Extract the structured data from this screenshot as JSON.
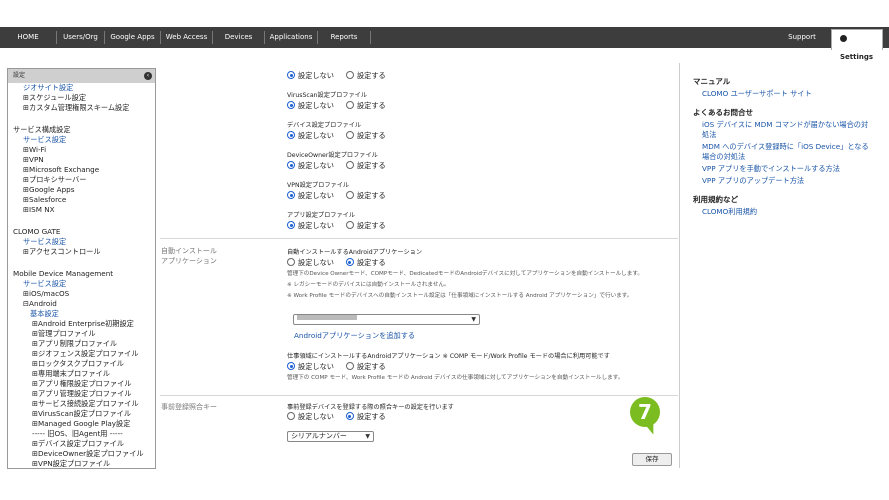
{
  "topnav": {
    "tabs": [
      "HOME",
      "Users/Org",
      "Google Apps",
      "Web Access",
      "Devices",
      "Applications",
      "Reports"
    ],
    "support": "Support",
    "settings": "Settings"
  },
  "sidebar": {
    "header": "設定",
    "items": [
      "ジオサイト設定",
      "⊞スケジュール設定",
      "⊞カスタム管理権限スキーム設定",
      "サービス構成設定",
      "サービス設定",
      "⊞Wi-Fi",
      "⊞VPN",
      "⊞Microsoft Exchange",
      "⊞プロキシサーバー",
      "⊞Google Apps",
      "⊞Salesforce",
      "⊞ISM NX",
      "CLOMO GATE",
      "サービス設定",
      "⊞アクセスコントロール",
      "Mobile Device Management",
      "サービス設定",
      "⊞iOS/macOS",
      "⊟Android",
      "基本設定",
      "⊞Android Enterprise初期設定",
      "⊞管理プロファイル",
      "⊞アプリ制限プロファイル",
      "⊞ジオフェンス設定プロファイル",
      "⊞ロックタスクプロファイル",
      "⊞専用端末プロファイル",
      "⊞アプリ権限設定プロファイル",
      "⊞アプリ管理設定プロファイル",
      "⊞サービス接続設定プロファイル",
      "⊞VirusScan設定プロファイル",
      "⊞Managed Google Play設定",
      "----- 旧OS、旧Agent用 -----",
      "⊞デバイス設定プロファイル",
      "⊞DeviceOwner設定プロファイル",
      "⊞VPN設定プロファイル"
    ]
  },
  "main": {
    "opt_off": "設定しない",
    "opt_on": "設定する",
    "profiles": [
      "VirusScan設定プロファイル",
      "デバイス設定プロファイル",
      "DeviceOwner設定プロファイル",
      "VPN設定プロファイル",
      "アプリ設定プロファイル"
    ],
    "auto_install_label": "自動インストール\nアプリケーション",
    "auto_install_title": "自動インストールするAndroidアプリケーション",
    "auto_install_notes": [
      "管理下のDevice Ownerモード、COMPモード、DedicatedモードのAndroidデバイスに対してアプリケーションを自動インストールします。",
      "※ レガシーモードのデバイスには自動インストールされません。",
      "※ Work Profile モードのデバイスへの自動インストール設定は「仕事領域にインストールする Android アプリケーション」で行います。"
    ],
    "add_app_link": "Androidアプリケーションを追加する",
    "work_title": "仕事領域にインストールするAndroidアプリケーション ※ COMP モード/Work Profile モードの場合に利用可能です",
    "work_note": "管理下の COMP モード、Work Profile モードの Android デバイスの仕事領域に対してアプリケーションを自動インストールします。",
    "prereg_label": "事前登録照合キー",
    "prereg_title": "事前登録デバイスを登録する際の照合キーの設定を行います",
    "prereg_select": "シリアルナンバー",
    "save": "保存",
    "step": "7"
  },
  "right": {
    "h1": "マニュアル",
    "l1": "CLOMO ユーザーサポート サイト",
    "h2": "よくあるお問合せ",
    "faq": [
      "iOS デバイスに MDM コマンドが届かない場合の対",
      "処法",
      "MDM へのデバイス登録時に「iOS Device」となる",
      "場合の対処法",
      "VPP アプリを手動でインストールする方法",
      "VPP アプリのアップデート方法"
    ],
    "h3": "利用規約など",
    "l3": "CLOMO利用規約"
  }
}
